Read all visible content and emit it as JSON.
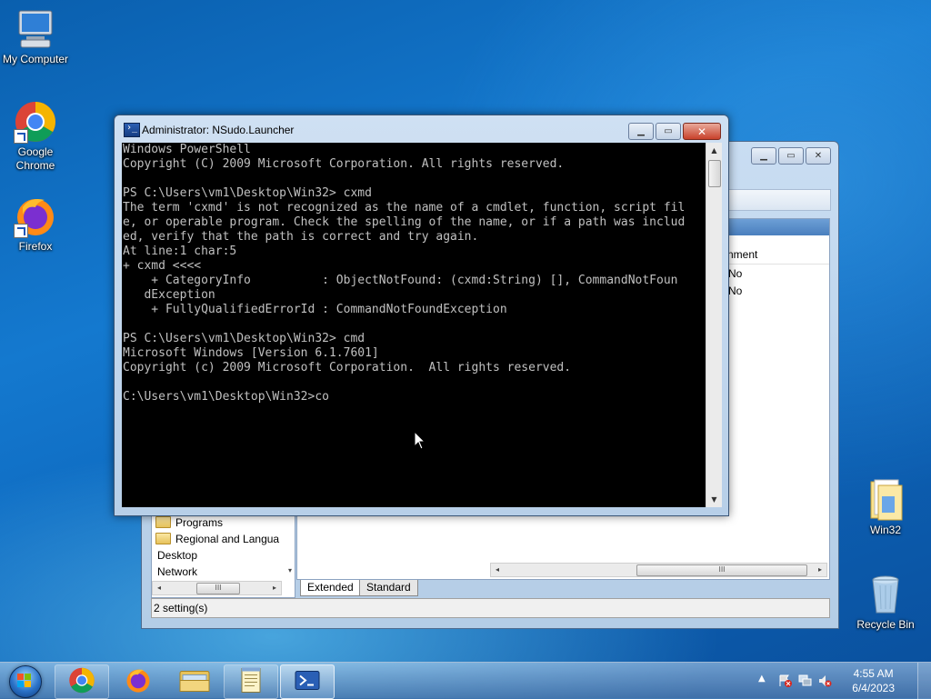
{
  "desktop": {
    "icons": [
      {
        "label": "My Computer",
        "icon": "computer-icon"
      },
      {
        "label": "Google Chrome",
        "icon": "chrome-icon"
      },
      {
        "label": "Firefox",
        "icon": "firefox-icon"
      },
      {
        "label": "Win32",
        "icon": "folder-icon"
      },
      {
        "label": "Recycle Bin",
        "icon": "recycle-bin-icon"
      }
    ]
  },
  "console": {
    "title": "Administrator: NSudo.Launcher",
    "lines": [
      "Windows PowerShell",
      "Copyright (C) 2009 Microsoft Corporation. All rights reserved.",
      "",
      "PS C:\\Users\\vm1\\Desktop\\Win32> cxmd",
      "The term 'cxmd' is not recognized as the name of a cmdlet, function, script fil",
      "e, or operable program. Check the spelling of the name, or if a path was includ",
      "ed, verify that the path is correct and try again.",
      "At line:1 char:5",
      "+ cxmd <<<<",
      "    + CategoryInfo          : ObjectNotFound: (cxmd:String) [], CommandNotFoun",
      "   dException",
      "    + FullyQualifiedErrorId : CommandNotFoundException",
      "",
      "PS C:\\Users\\vm1\\Desktop\\Win32> cmd",
      "Microsoft Windows [Version 6.1.7601]",
      "Copyright (c) 2009 Microsoft Corporation.  All rights reserved.",
      "",
      "C:\\Users\\vm1\\Desktop\\Win32>co"
    ]
  },
  "background_window": {
    "column_header": "nment",
    "values": [
      "No",
      "No"
    ],
    "tree_items": [
      "Programs",
      "Regional and Langua",
      "Desktop",
      "Network"
    ],
    "tabs": [
      "Extended",
      "Standard"
    ],
    "status": "2 setting(s)",
    "scroll_grip": "III"
  },
  "taskbar": {
    "apps": [
      "chrome-icon",
      "firefox-icon",
      "explorer-icon",
      "notepad-icon",
      "powershell-icon"
    ],
    "time": "4:55 AM",
    "date": "6/4/2023"
  },
  "colors": {
    "console_bg": "#000000",
    "console_fg": "#c0c0c0",
    "desktop": "#1470c8"
  }
}
